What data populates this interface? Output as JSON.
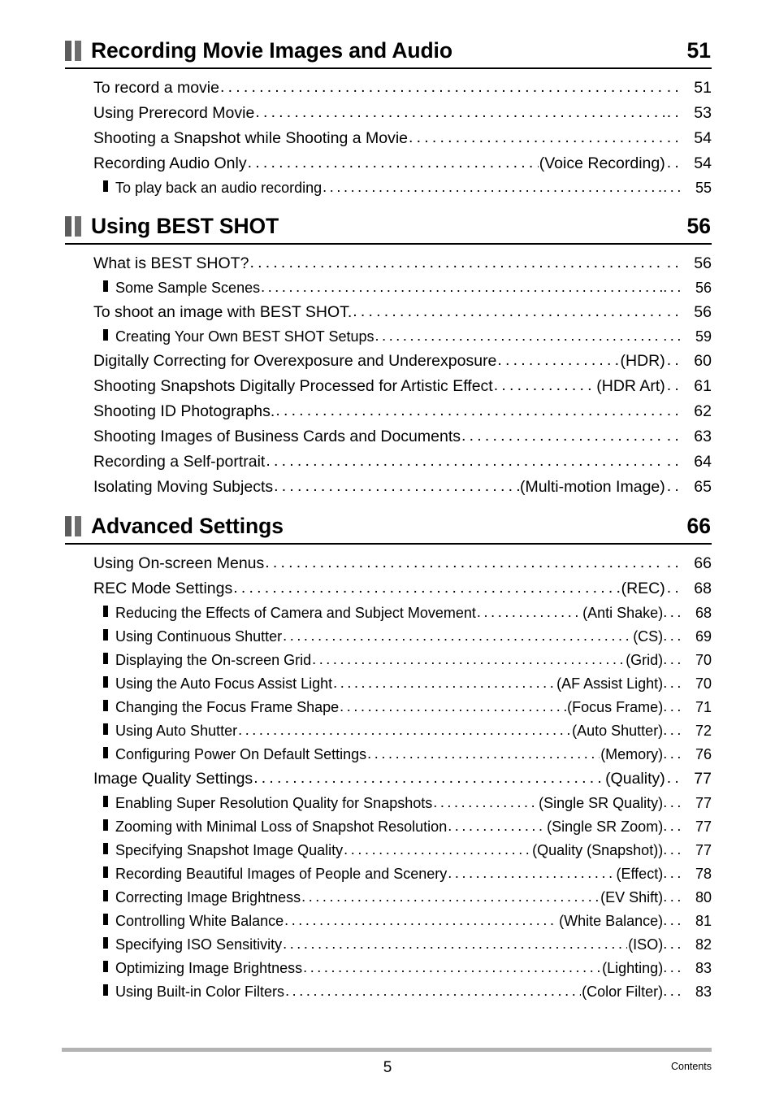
{
  "document": {
    "footer_page_number": "5",
    "footer_label": "Contents"
  },
  "sections": [
    {
      "title": "Recording Movie Images and Audio",
      "page": "51",
      "entries": [
        {
          "level": 1,
          "text": "To record a movie",
          "paren": "",
          "page": "51"
        },
        {
          "level": 1,
          "text": "Using Prerecord Movie",
          "paren": "",
          "page": "53"
        },
        {
          "level": 1,
          "text": "Shooting a Snapshot while Shooting a Movie",
          "paren": "",
          "page": "54"
        },
        {
          "level": 1,
          "text": "Recording Audio Only",
          "paren": "(Voice Recording)",
          "page": "54"
        },
        {
          "level": 2,
          "text": "To play back an audio recording",
          "paren": "",
          "page": "55"
        }
      ]
    },
    {
      "title": "Using BEST SHOT",
      "page": "56",
      "entries": [
        {
          "level": 1,
          "text": "What is BEST SHOT?",
          "paren": "",
          "page": "56"
        },
        {
          "level": 2,
          "text": "Some Sample Scenes",
          "paren": "",
          "page": "56"
        },
        {
          "level": 1,
          "text": "To shoot an image with BEST SHOT.",
          "paren": "",
          "page": "56"
        },
        {
          "level": 2,
          "text": "Creating Your Own BEST SHOT Setups",
          "paren": "",
          "page": "59"
        },
        {
          "level": 1,
          "text": "Digitally Correcting for Overexposure and Underexposure",
          "paren": "(HDR)",
          "page": "60"
        },
        {
          "level": 1,
          "text": "Shooting Snapshots Digitally Processed for Artistic Effect",
          "paren": "(HDR Art)",
          "page": "61"
        },
        {
          "level": 1,
          "text": "Shooting ID Photographs.",
          "paren": "",
          "page": "62"
        },
        {
          "level": 1,
          "text": "Shooting Images of Business Cards and Documents",
          "paren": "",
          "page": "63"
        },
        {
          "level": 1,
          "text": "Recording a Self-portrait",
          "paren": "",
          "page": "64"
        },
        {
          "level": 1,
          "text": "Isolating Moving Subjects",
          "paren": "(Multi-motion Image)",
          "page": "65"
        }
      ]
    },
    {
      "title": "Advanced Settings",
      "page": "66",
      "entries": [
        {
          "level": 1,
          "text": "Using On-screen Menus",
          "paren": "",
          "page": "66"
        },
        {
          "level": 1,
          "text": "REC Mode Settings",
          "paren": "(REC)",
          "page": "68"
        },
        {
          "level": 2,
          "text": "Reducing the Effects of Camera and Subject Movement",
          "paren": "(Anti Shake)",
          "page": "68"
        },
        {
          "level": 2,
          "text": "Using Continuous Shutter",
          "paren": "(CS)",
          "page": "69"
        },
        {
          "level": 2,
          "text": "Displaying the On-screen Grid",
          "paren": "(Grid)",
          "page": "70"
        },
        {
          "level": 2,
          "text": "Using the Auto Focus Assist Light",
          "paren": "(AF Assist Light)",
          "page": "70"
        },
        {
          "level": 2,
          "text": "Changing the Focus Frame Shape",
          "paren": "(Focus Frame)",
          "page": "71"
        },
        {
          "level": 2,
          "text": "Using Auto Shutter",
          "paren": "(Auto Shutter)",
          "page": "72"
        },
        {
          "level": 2,
          "text": "Configuring Power On Default Settings",
          "paren": "(Memory)",
          "page": "76"
        },
        {
          "level": 1,
          "text": "Image Quality Settings",
          "paren": "(Quality)",
          "page": "77"
        },
        {
          "level": 2,
          "text": "Enabling Super Resolution Quality for Snapshots",
          "paren": "(Single SR Quality)",
          "page": "77"
        },
        {
          "level": 2,
          "text": "Zooming with Minimal Loss of Snapshot Resolution",
          "paren": "(Single SR Zoom)",
          "page": "77"
        },
        {
          "level": 2,
          "text": "Specifying Snapshot Image Quality",
          "paren": "(Quality (Snapshot))",
          "page": "77"
        },
        {
          "level": 2,
          "text": "Recording Beautiful Images of People and Scenery",
          "paren": "(Effect)",
          "page": "78"
        },
        {
          "level": 2,
          "text": "Correcting Image Brightness",
          "paren": "(EV Shift)",
          "page": "80"
        },
        {
          "level": 2,
          "text": "Controlling White Balance",
          "paren": "(White Balance)",
          "page": "81"
        },
        {
          "level": 2,
          "text": "Specifying ISO Sensitivity",
          "paren": "(ISO)",
          "page": "82"
        },
        {
          "level": 2,
          "text": "Optimizing Image Brightness",
          "paren": "(Lighting)",
          "page": "83"
        },
        {
          "level": 2,
          "text": "Using Built-in Color Filters",
          "paren": "(Color Filter)",
          "page": "83"
        }
      ]
    }
  ],
  "style": {
    "section_mark_color": "#5c5c5c",
    "footer_rule_color": "#b3b3b3",
    "text_color": "#000000"
  }
}
